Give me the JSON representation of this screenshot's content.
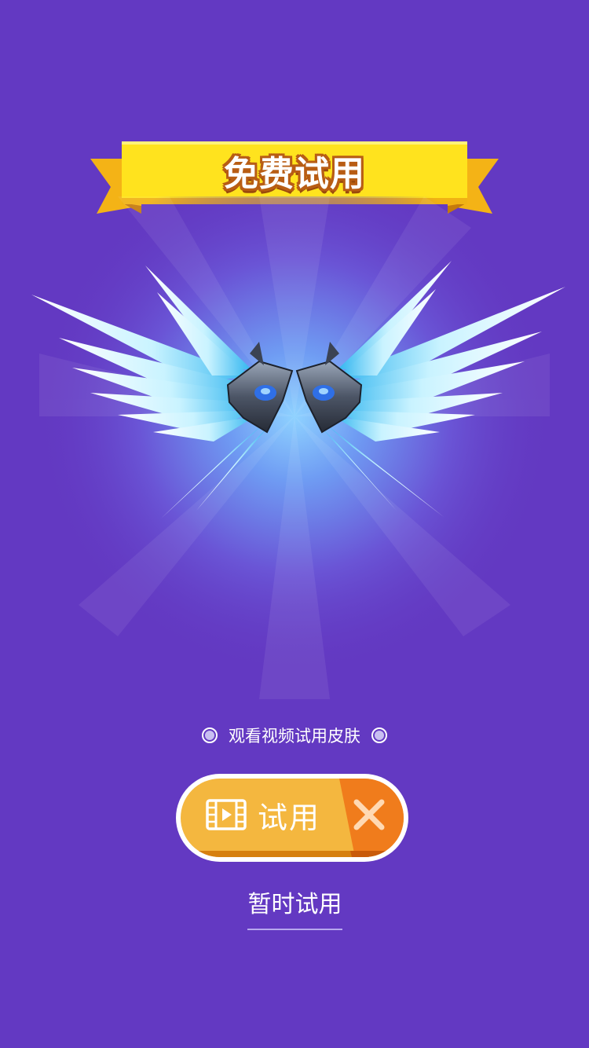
{
  "banner": {
    "title": "免费试用"
  },
  "item": {
    "name_icon": "ice-crystal-wings"
  },
  "hint": {
    "text": "观看视频试用皮肤"
  },
  "trial_button": {
    "label": "试用",
    "icon": "video-film-icon",
    "close_icon": "close-icon"
  },
  "temp_link": {
    "label": "暂时试用"
  },
  "colors": {
    "background": "#6339c2",
    "ribbon": "#ffe31e",
    "ribbon_shadow": "#f0a612",
    "button": "#f4b73f",
    "button_close": "#f07c1c",
    "title_stroke": "#b85d14"
  }
}
